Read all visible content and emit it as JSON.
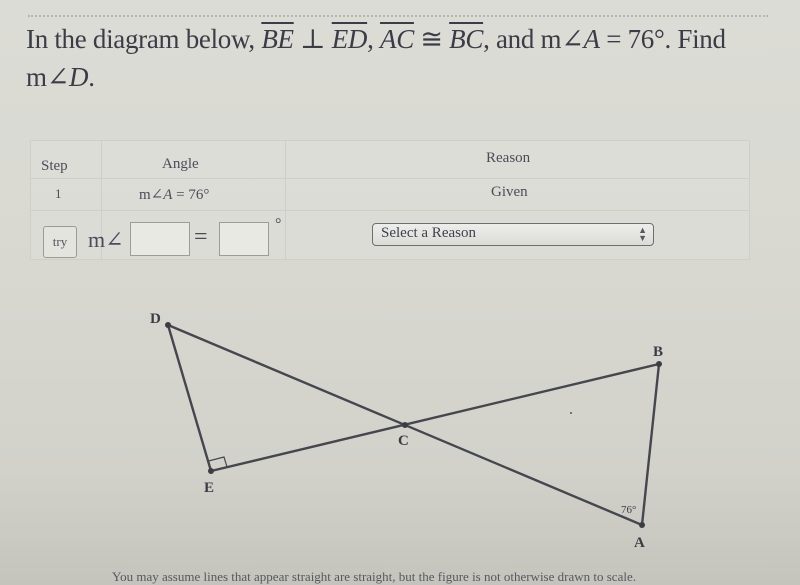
{
  "question": {
    "prefix": "In the diagram below, ",
    "seg1": "BE",
    "perp": " ⊥ ",
    "seg2": "ED",
    "comma1": ", ",
    "seg3": "AC",
    "cong": " ≅ ",
    "seg4": "BC",
    "mid": ", and m∠",
    "angle_var": "A",
    "value": " = 76°. Find",
    "line2_prefix": "m∠",
    "line2_var": "D",
    "line2_suffix": "."
  },
  "steps_table": {
    "headers": {
      "step": "Step",
      "angle": "Angle",
      "reason": "Reason"
    },
    "rows": [
      {
        "step": "1",
        "angle_prefix": "m∠",
        "angle_var": "A",
        "angle_value": " = 76°",
        "reason": "Given"
      }
    ],
    "input_row": {
      "try_label": "try",
      "angle_prefix": "m∠",
      "angle_name_value": "",
      "equals": "=",
      "angle_value": "",
      "degree_symbol": "°",
      "reason_select": "Select a Reason"
    }
  },
  "diagram": {
    "points": {
      "D": "D",
      "E": "E",
      "C": "C",
      "B": "B",
      "A": "A"
    },
    "angle_label_A": "76°",
    "right_angle_at": "E"
  },
  "footnote": "You may assume lines that appear straight are straight, but the figure is not otherwise drawn to scale."
}
